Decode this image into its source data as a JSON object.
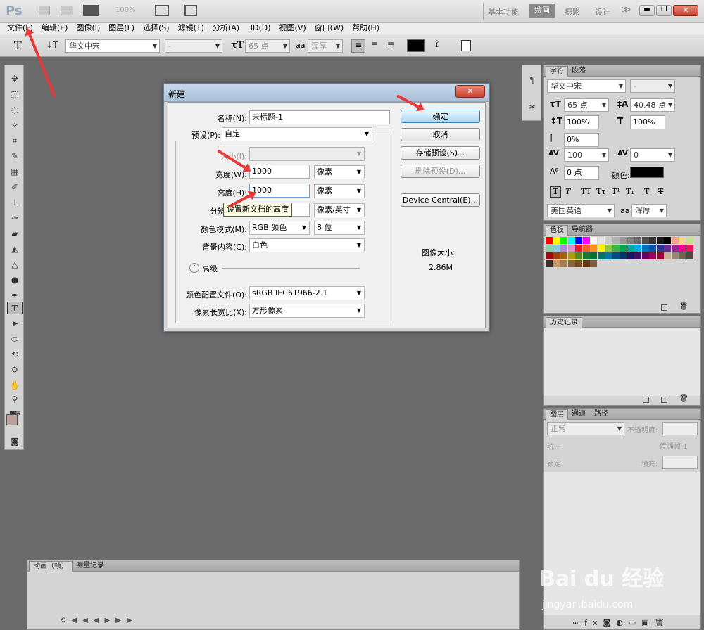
{
  "app": {
    "logo": "Ps",
    "zoom": "100%",
    "workspaces": [
      "基本功能",
      "绘画",
      "摄影",
      "设计"
    ],
    "more": "≫"
  },
  "menu": [
    "文件(F)",
    "编辑(E)",
    "图像(I)",
    "图层(L)",
    "选择(S)",
    "滤镜(T)",
    "分析(A)",
    "3D(D)",
    "视图(V)",
    "窗口(W)",
    "帮助(H)"
  ],
  "options": {
    "font_family": "华文中宋",
    "font_style": "-",
    "font_size": "65 点",
    "aa_label": "aa",
    "aa_value": "浑厚",
    "text_color": "#000000"
  },
  "dialog": {
    "title": "新建",
    "name_label": "名称(N):",
    "name_value": "未标题-1",
    "preset_label": "预设(P):",
    "preset_value": "自定",
    "size_label": "大小(I):",
    "width_label": "宽度(W):",
    "width_value": "1000",
    "width_unit": "像素",
    "height_label": "高度(H):",
    "height_value": "1000",
    "height_unit": "像素",
    "resolution_label": "分辨率(R):",
    "resolution_unit": "像素/英寸",
    "tooltip": "设置新文档的高度",
    "mode_label": "颜色模式(M):",
    "mode_value": "RGB 颜色",
    "bits_value": "8 位",
    "bg_label": "背景内容(C):",
    "bg_value": "白色",
    "advanced_label": "高级",
    "profile_label": "颜色配置文件(O):",
    "profile_value": "sRGB IEC61966-2.1",
    "aspect_label": "像素长宽比(X):",
    "aspect_value": "方形像素",
    "ok": "确定",
    "cancel": "取消",
    "save_preset": "存储预设(S)...",
    "delete_preset": "删除预设(D)...",
    "device_central": "Device Central(E)...",
    "image_size_label": "图像大小:",
    "image_size_value": "2.86M"
  },
  "char_panel": {
    "tabs": [
      "字符",
      "段落"
    ],
    "font": "华文中宋",
    "style": "-",
    "size": "65 点",
    "leading": "40.48 点",
    "vscale": "100%",
    "hscale": "100%",
    "tsume": "0%",
    "tracking": "100",
    "kerning": "0",
    "baseline": "0 点",
    "color_label": "颜色:",
    "language": "美国英语",
    "aa_label": "aa",
    "aa": "浑厚"
  },
  "swatches_panel": {
    "tabs": [
      "色板",
      "导航器"
    ]
  },
  "history_panel": {
    "tabs": [
      "历史记录"
    ]
  },
  "layers_panel": {
    "tabs": [
      "图层",
      "通道",
      "路径"
    ],
    "blend": "正常",
    "opacity_label": "不透明度:",
    "unify_label": "统一:",
    "propagate_label": "传播帧 1",
    "lock_label": "锁定:",
    "fill_label": "填充:"
  },
  "timeline": {
    "tabs": [
      "动画（帧）",
      "测量记录"
    ]
  },
  "watermark": {
    "brand": "Bai du 经验",
    "url": "jingyan.baidu.com"
  },
  "colors": {
    "accent_red": "#e53a3a",
    "fg_color": "#b9a09a",
    "bg_color": "#000000"
  }
}
